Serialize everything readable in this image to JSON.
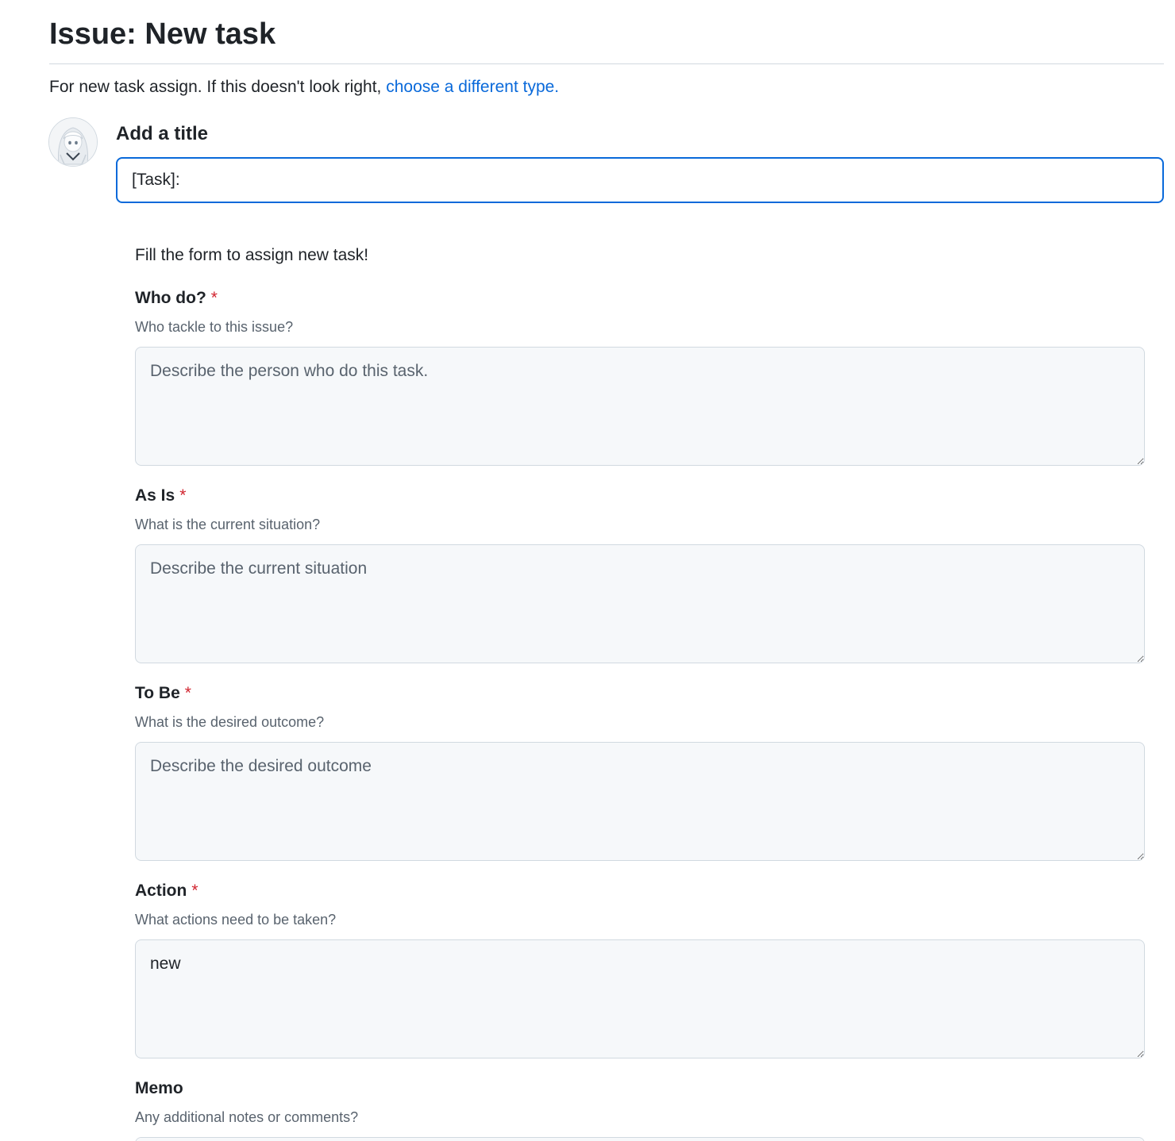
{
  "page": {
    "title": "Issue: New task",
    "subtitle_prefix": "For new task assign. If this doesn't look right,",
    "subtitle_link": "choose a different type."
  },
  "avatar": {
    "alt": "user avatar"
  },
  "title_field": {
    "label": "Add a title",
    "value": "[Task]:"
  },
  "form": {
    "intro": "Fill the form to assign new task!",
    "required_marker": "*",
    "fields": [
      {
        "label": "Who do?",
        "required": true,
        "description": "Who tackle to this issue?",
        "placeholder": "Describe the person who do this task.",
        "value": ""
      },
      {
        "label": "As Is",
        "required": true,
        "description": "What is the current situation?",
        "placeholder": "Describe the current situation",
        "value": ""
      },
      {
        "label": "To Be",
        "required": true,
        "description": "What is the desired outcome?",
        "placeholder": "Describe the desired outcome",
        "value": ""
      },
      {
        "label": "Action",
        "required": true,
        "description": "What actions need to be taken?",
        "placeholder": "",
        "value": "new"
      },
      {
        "label": "Memo",
        "required": false,
        "description": "Any additional notes or comments?",
        "placeholder": "",
        "value": ""
      }
    ]
  },
  "colors": {
    "link": "#0969da",
    "required": "#d1242f",
    "focus_border": "#0969da",
    "textarea_bg": "#f6f8fa"
  }
}
